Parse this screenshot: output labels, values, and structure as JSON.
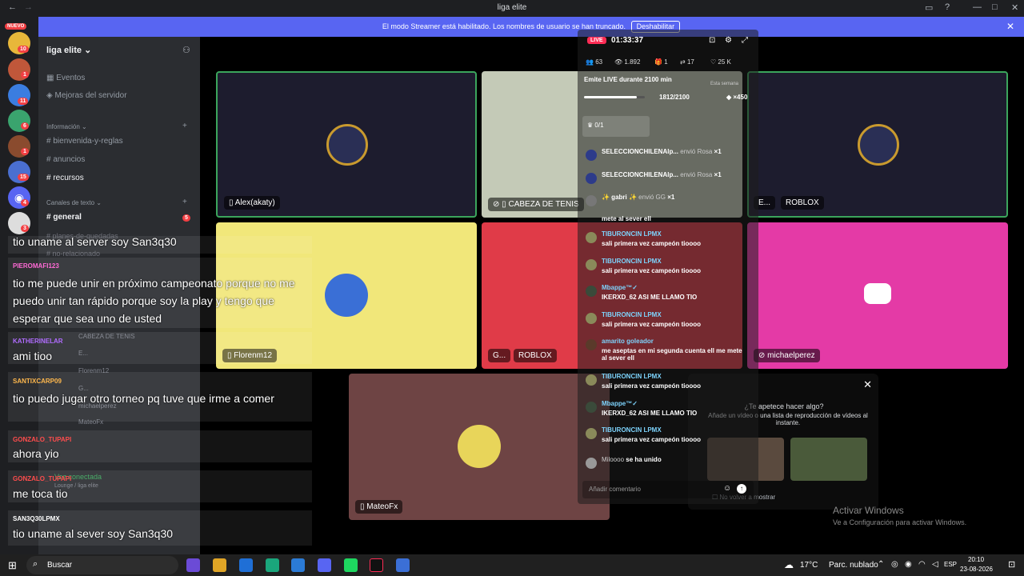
{
  "window": {
    "title": "liga elite"
  },
  "servers": [
    {
      "badge": "NUEVO"
    },
    {
      "badge": "10"
    },
    {
      "badge": "1"
    },
    {
      "badge": "11"
    },
    {
      "badge": "6"
    },
    {
      "badge": "1"
    },
    {
      "badge": "15"
    },
    {
      "badge": "4"
    },
    {
      "badge": "3"
    }
  ],
  "banner": {
    "text": "El modo Streamer está habilitado. Los nombres de usuario se han truncado.",
    "button": "Deshabilitar"
  },
  "sidebar": {
    "server_name": "liga elite",
    "items": [
      {
        "label": "Eventos"
      },
      {
        "label": "Mejoras del servidor"
      }
    ],
    "info_category": "Información",
    "info_channels": [
      "bienvenida-y-reglas",
      "anuncios",
      "recursos"
    ],
    "text_category": "Canales de texto",
    "text_channels": [
      {
        "label": "general",
        "badge": "5"
      },
      {
        "label": "planes-de-quedadas"
      },
      {
        "label": "no-relacionado"
      }
    ],
    "voice_users": [
      "CABEZA DE TENIS",
      "E...",
      "Florenm12",
      "G...",
      "michaelperez",
      "MateoFx"
    ],
    "voice_connected": "Voz conectada",
    "voice_location": "Lounge / liga elite"
  },
  "tiles": {
    "t1": "Alex(akaty)",
    "t2": "CABEZA DE TENIS",
    "t3a": "E...",
    "t3b": "ROBLOX",
    "t4": "Florenm12",
    "t5a": "G...",
    "t5b": "ROBLOX",
    "t6": "michaelperez",
    "t7": "MateoFx"
  },
  "overlay_chat": [
    {
      "name": "",
      "msg": "tio uname al server soy San3q30"
    },
    {
      "name": "PIEROMAFI123",
      "msg": "tio me puede unir en próximo campeonato porque no me puedo unir tan rápido porque soy la play y tengo que esperar que sea uno de usted"
    },
    {
      "name": "KATHERINELAR",
      "msg": "ami tioo"
    },
    {
      "name": "SANTIXCARP09",
      "msg": "tio puedo jugar otro torneo pq tuve que irme a comer"
    },
    {
      "name": "GONZALO_TUPAPI",
      "msg": "ahora yio"
    },
    {
      "name": "GONZALO_TUPAPI",
      "msg": "me toca tio"
    },
    {
      "name": "SAN3Q30LPMX",
      "msg": "tio uname al sever soy San3q30"
    }
  ],
  "live": {
    "badge": "LIVE",
    "timer": "01:33:37",
    "stats": [
      "63",
      "1.892",
      "1",
      "17",
      "25 K"
    ],
    "goal_title": "Emite LIVE durante 2100 min",
    "goal_period": "Esta semana",
    "goal_progress": "1812/2100",
    "goal_fraction": 0.863,
    "goal_reward": "×450",
    "counter": "0/1",
    "comments": [
      {
        "name": "SELECCIONCHILENAlp...",
        "msg": "envió Rosa",
        "extra": "×1"
      },
      {
        "name": "SELECCIONCHILENAlp...",
        "msg": "envió Rosa",
        "extra": "×1"
      },
      {
        "name": "✨ gabri ✨",
        "msg": "envió GG",
        "extra": "×1"
      },
      {
        "name": "",
        "msg": "mete al sever ell"
      },
      {
        "name": "TIBURONCIN LPMX",
        "msg": "sali primera vez campeón tioooo"
      },
      {
        "name": "TIBURONCIN LPMX",
        "msg": "sali primera vez campeón tioooo"
      },
      {
        "name": "Mbappe™✓",
        "msg": "IKERXD_62 ASI ME LLAMO TIO"
      },
      {
        "name": "TIBURONCIN LPMX",
        "msg": "sali primera vez campeón tioooo"
      },
      {
        "name": "amarito goleador",
        "msg": "me aseptas en mi segunda cuenta ell me mete al sever ell"
      },
      {
        "name": "TIBURONCIN LPMX",
        "msg": "sali primera vez campeón tioooo"
      },
      {
        "name": "Mbappe™✓",
        "msg": "IKERXD_62 ASI ME LLAMO TIO"
      },
      {
        "name": "TIBURONCIN LPMX",
        "msg": "sali primera vez campeón tioooo"
      },
      {
        "name": "Miloooo",
        "msg": "se ha unido"
      }
    ],
    "comment_placeholder": "Añadir comentario"
  },
  "promo": {
    "title": "¿Te apetece hacer algo?",
    "body": "Añade un vídeo o una lista de reproducción de vídeos al instante.",
    "no_show": "No volver a mostrar"
  },
  "activate": {
    "title": "Activar Windows",
    "body": "Ve a Configuración para activar Windows."
  },
  "taskbar": {
    "search": "Buscar",
    "weather": "17°C",
    "weather_desc": "Parc. nublado",
    "lang": "ESP",
    "time": "20:10",
    "date": "23-08-2026"
  },
  "colors": {
    "accent": "#5865f2",
    "live": "#fe2c55"
  }
}
